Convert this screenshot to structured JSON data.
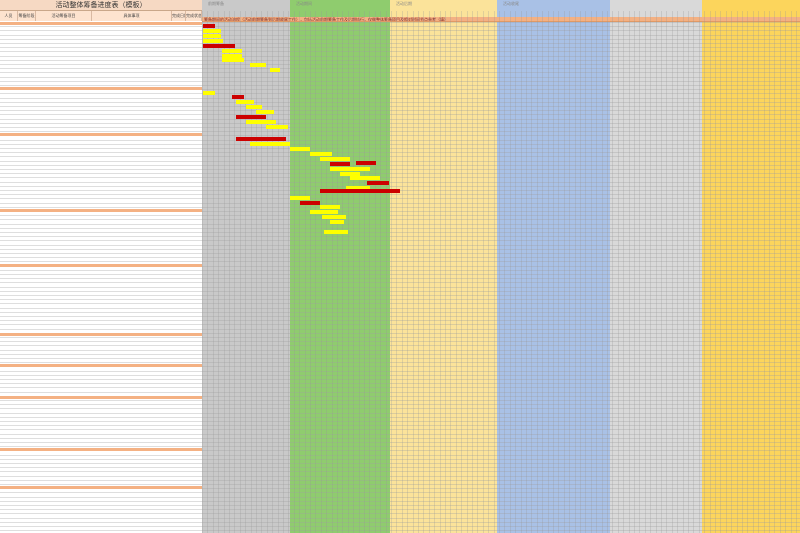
{
  "sheet": {
    "title": "活动整体筹备进度表（模板）",
    "summary_note": "筹备期间的活动流程（活动前期筹备到后期收尾工作），包括活动前期筹备工作及后期执行，仅做整体筹备项目及相对时间节点参考（填）"
  },
  "headers": [
    {
      "name": "col-owner",
      "label": "人员"
    },
    {
      "name": "col-stage",
      "label": "筹备阶段"
    },
    {
      "name": "col-task",
      "label": "活动筹备项目"
    },
    {
      "name": "col-content",
      "label": "具体事项"
    },
    {
      "name": "col-date",
      "label": "完成日期"
    },
    {
      "name": "col-status",
      "label": "完成状态"
    }
  ],
  "zones": [
    {
      "name": "zone-prep",
      "label": "前期筹备",
      "color": "#c9c9c9"
    },
    {
      "name": "zone-green",
      "label": "活动期间",
      "color": "#8fcc6e"
    },
    {
      "name": "zone-yellow",
      "label": "活动后期",
      "color": "#fbe39a"
    },
    {
      "name": "zone-blue",
      "label": "活动收尾",
      "color": "#a9c1e6"
    },
    {
      "name": "zone-gray",
      "label": "",
      "color": "#d9d9d9"
    },
    {
      "name": "zone-gold",
      "label": "",
      "color": "#fcd55c"
    }
  ],
  "colors": {
    "bar_yellow": "#ffff00",
    "bar_red": "#cc0000",
    "section": "#f4b183"
  }
}
